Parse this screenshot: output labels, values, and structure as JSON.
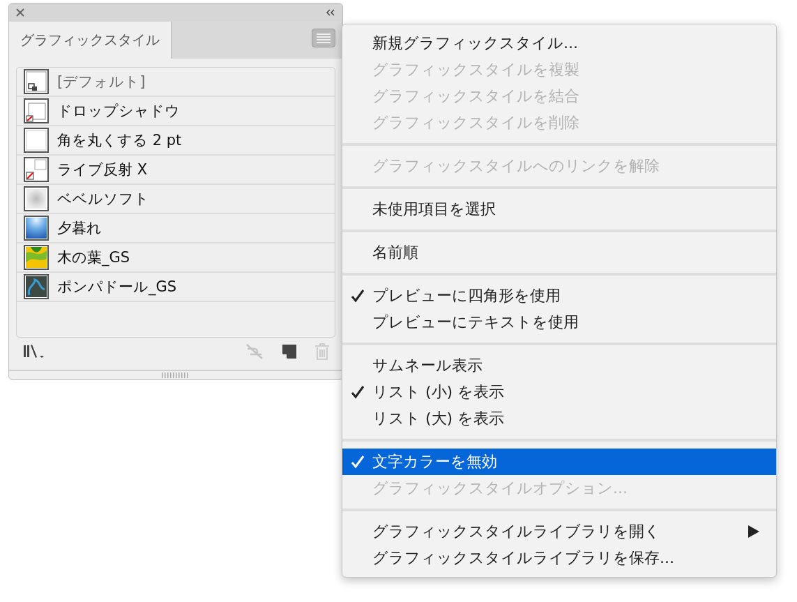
{
  "panel": {
    "tabs": [
      {
        "label": "グラフィックスタイル",
        "selected": true
      }
    ],
    "styles": [
      {
        "name": "[デフォルト]",
        "kind": "default"
      },
      {
        "name": "ドロップシャドウ",
        "kind": "shadow"
      },
      {
        "name": "角を丸くする 2 pt",
        "kind": "plain"
      },
      {
        "name": "ライブ反射 X",
        "kind": "reflect"
      },
      {
        "name": "ベベルソフト",
        "kind": "bevel"
      },
      {
        "name": "夕暮れ",
        "kind": "gradient"
      },
      {
        "name": "木の葉_GS",
        "kind": "leaf"
      },
      {
        "name": "ポンパドール_GS",
        "kind": "pattern"
      }
    ]
  },
  "menu": {
    "groups": [
      [
        {
          "label": "新規グラフィックスタイル...",
          "checked": false,
          "disabled": false,
          "selected": false,
          "submenu": false
        },
        {
          "label": "グラフィックスタイルを複製",
          "checked": false,
          "disabled": true,
          "selected": false,
          "submenu": false
        },
        {
          "label": "グラフィックスタイルを結合",
          "checked": false,
          "disabled": true,
          "selected": false,
          "submenu": false
        },
        {
          "label": "グラフィックスタイルを削除",
          "checked": false,
          "disabled": true,
          "selected": false,
          "submenu": false
        }
      ],
      [
        {
          "label": "グラフィックスタイルへのリンクを解除",
          "checked": false,
          "disabled": true,
          "selected": false,
          "submenu": false
        }
      ],
      [
        {
          "label": "未使用項目を選択",
          "checked": false,
          "disabled": false,
          "selected": false,
          "submenu": false
        }
      ],
      [
        {
          "label": "名前順",
          "checked": false,
          "disabled": false,
          "selected": false,
          "submenu": false
        }
      ],
      [
        {
          "label": "プレビューに四角形を使用",
          "checked": true,
          "disabled": false,
          "selected": false,
          "submenu": false
        },
        {
          "label": "プレビューにテキストを使用",
          "checked": false,
          "disabled": false,
          "selected": false,
          "submenu": false
        }
      ],
      [
        {
          "label": "サムネール表示",
          "checked": false,
          "disabled": false,
          "selected": false,
          "submenu": false
        },
        {
          "label": "リスト (小) を表示",
          "checked": true,
          "disabled": false,
          "selected": false,
          "submenu": false
        },
        {
          "label": "リスト (大) を表示",
          "checked": false,
          "disabled": false,
          "selected": false,
          "submenu": false
        }
      ],
      [
        {
          "label": "文字カラーを無効",
          "checked": true,
          "disabled": false,
          "selected": true,
          "submenu": false
        },
        {
          "label": "グラフィックスタイルオプション...",
          "checked": false,
          "disabled": true,
          "selected": false,
          "submenu": false
        }
      ],
      [
        {
          "label": "グラフィックスタイルライブラリを開く",
          "checked": false,
          "disabled": false,
          "selected": false,
          "submenu": true
        },
        {
          "label": "グラフィックスタイルライブラリを保存...",
          "checked": false,
          "disabled": false,
          "selected": false,
          "submenu": false
        }
      ]
    ]
  }
}
